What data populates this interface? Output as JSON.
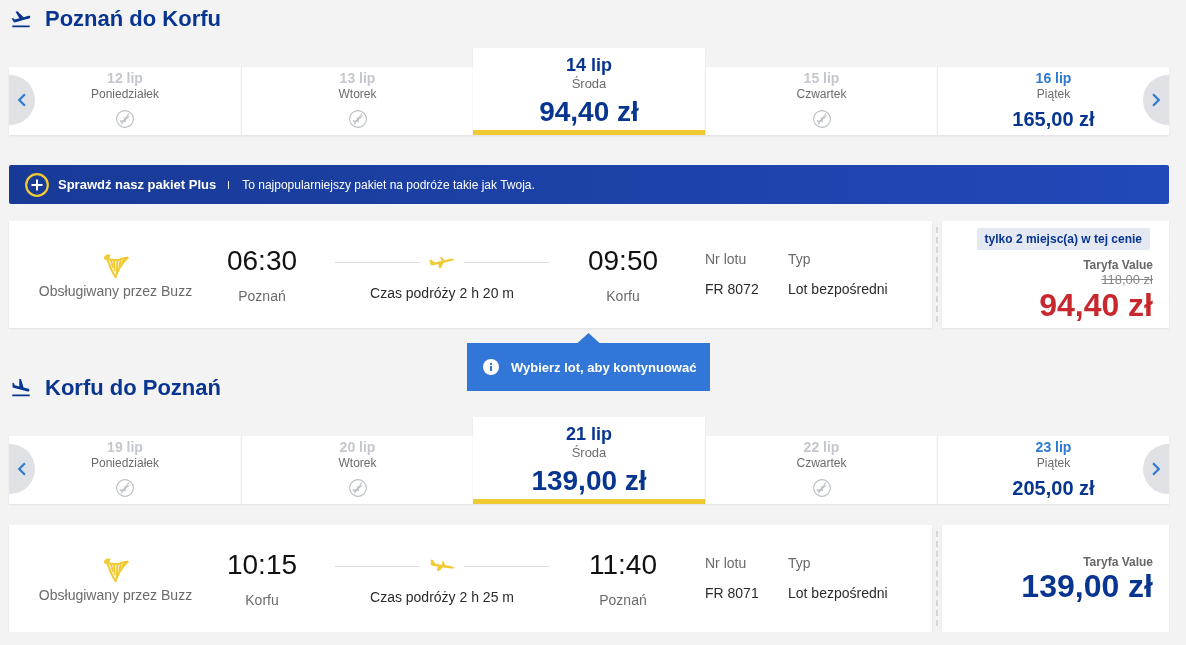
{
  "journeys": [
    {
      "kind": "outbound",
      "title": "Poznań do Korfu",
      "dates": [
        {
          "date": "12 lip",
          "weekday": "Poniedziałek",
          "available": false,
          "selected": false
        },
        {
          "date": "13 lip",
          "weekday": "Wtorek",
          "available": false,
          "selected": false
        },
        {
          "date": "14 lip",
          "weekday": "Środa",
          "price": "94,40 zł",
          "available": true,
          "selected": true
        },
        {
          "date": "15 lip",
          "weekday": "Czwartek",
          "available": false,
          "selected": false
        },
        {
          "date": "16 lip",
          "weekday": "Piątek",
          "price": "165,00 zł",
          "available": true,
          "selected": false
        }
      ],
      "promo": {
        "title": "Sprawdź nasz pakiet Plus",
        "text": "To najpopularniejszy pakiet na podróże takie jak Twoja."
      },
      "flight": {
        "operator": "Obsługiwany przez Buzz",
        "departure_time": "06:30",
        "departure_city": "Poznań",
        "duration": "Czas podróży 2 h 20 m",
        "arrival_time": "09:50",
        "arrival_city": "Korfu",
        "flight_number_label": "Nr lotu",
        "flight_number": "FR 8072",
        "type_label": "Typ",
        "type": "Lot bezpośredni",
        "seats_badge": "tylko 2 miejsc(a) w tej cenie",
        "fare": "Taryfa Value",
        "original_price": "118,00 zł",
        "price": "94,40 zł",
        "discounted": true
      },
      "tooltip": {
        "text": "Wybierz lot, aby kontynuować"
      }
    },
    {
      "kind": "return",
      "title": "Korfu do Poznań",
      "dates": [
        {
          "date": "19 lip",
          "weekday": "Poniedziałek",
          "available": false,
          "selected": false
        },
        {
          "date": "20 lip",
          "weekday": "Wtorek",
          "available": false,
          "selected": false
        },
        {
          "date": "21 lip",
          "weekday": "Środa",
          "price": "139,00 zł",
          "available": true,
          "selected": true
        },
        {
          "date": "22 lip",
          "weekday": "Czwartek",
          "available": false,
          "selected": false
        },
        {
          "date": "23 lip",
          "weekday": "Piątek",
          "price": "205,00 zł",
          "available": true,
          "selected": false
        }
      ],
      "flight": {
        "operator": "Obsługiwany przez Buzz",
        "departure_time": "10:15",
        "departure_city": "Korfu",
        "duration": "Czas podróży 2 h 25 m",
        "arrival_time": "11:40",
        "arrival_city": "Poznań",
        "flight_number_label": "Nr lotu",
        "flight_number": "FR 8071",
        "type_label": "Typ",
        "type": "Lot bezpośredni",
        "fare": "Taryfa Value",
        "price": "139,00 zł",
        "discounted": false
      }
    }
  ]
}
